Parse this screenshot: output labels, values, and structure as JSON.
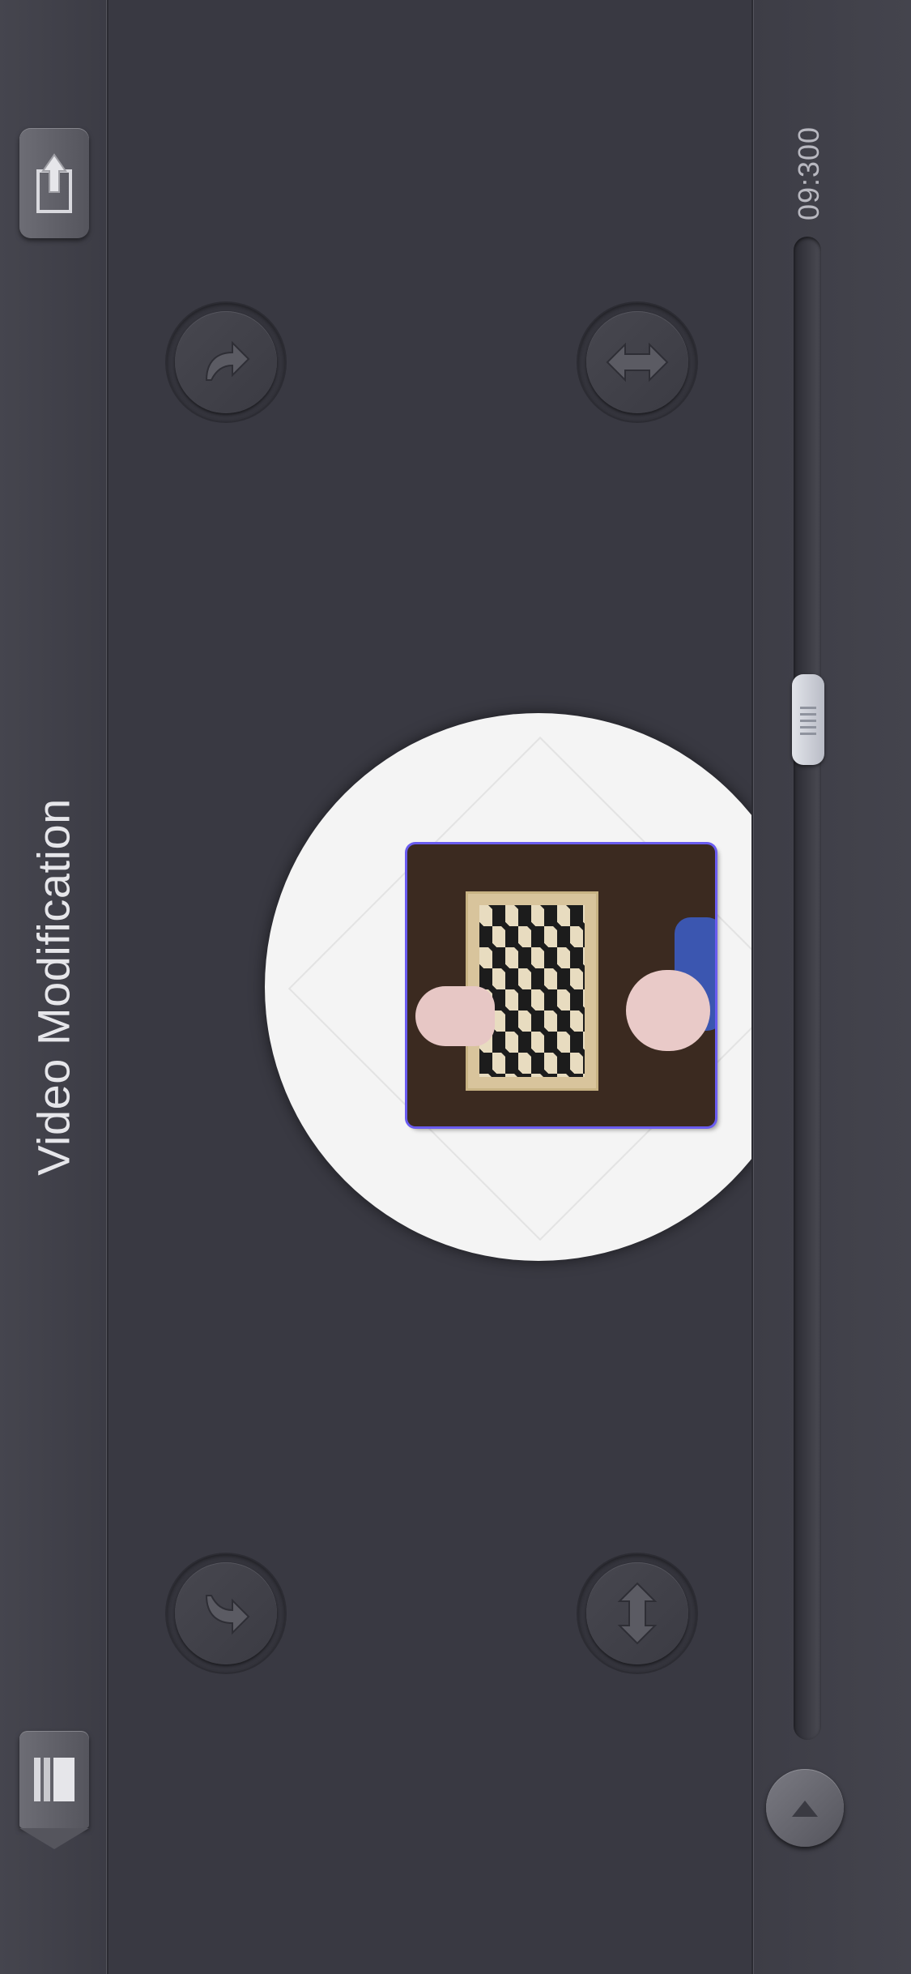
{
  "header": {
    "title": "Video Modification"
  },
  "toolbar": {
    "export_icon": "export-icon",
    "library_icon": "library-icon"
  },
  "controls": {
    "rotate_right_icon": "rotate-right-icon",
    "rotate_left_icon": "rotate-left-icon",
    "flip_horizontal_icon": "flip-horizontal-icon",
    "flip_vertical_icon": "flip-vertical-icon",
    "play_icon": "play-icon"
  },
  "timeline": {
    "time_label": "09:300",
    "position": 0.31
  },
  "preview": {
    "description_icon": "video-thumbnail",
    "accent_color": "#6a5cf0"
  }
}
